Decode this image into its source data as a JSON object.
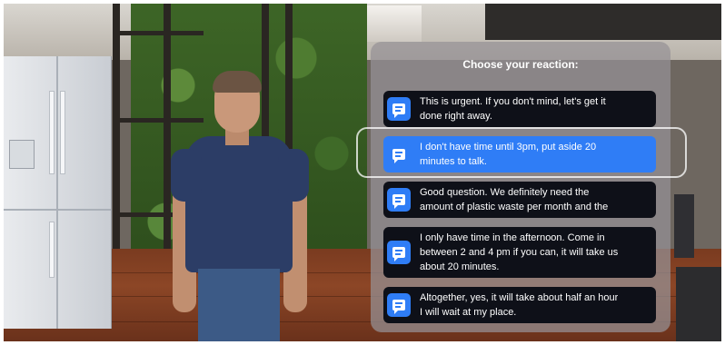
{
  "reaction_panel": {
    "title": "Choose your reaction:",
    "options": [
      {
        "text": "This is urgent. If you don't mind, let's get it\ndone right away.",
        "icon": "chat-bubble-icon",
        "selected": false
      },
      {
        "text": "I don't have time until 3pm, put aside 20\nminutes to talk.",
        "icon": "chat-bubble-icon",
        "selected": true
      },
      {
        "text": "Good question. We definitely need the\namount of plastic waste per month and the",
        "icon": "chat-bubble-icon",
        "selected": false
      },
      {
        "text": "I only have time in the afternoon. Come in\nbetween 2 and 4 pm if you can, it will take us\nabout 20 minutes.",
        "icon": "chat-bubble-icon",
        "selected": false
      },
      {
        "text": "Altogether, yes, it will take about half an hour\nI will wait at my place.",
        "icon": "chat-bubble-icon",
        "selected": false
      }
    ]
  },
  "colors": {
    "accent": "#2f7df6",
    "option_background": "#0e1018",
    "panel_background": "#969296"
  }
}
